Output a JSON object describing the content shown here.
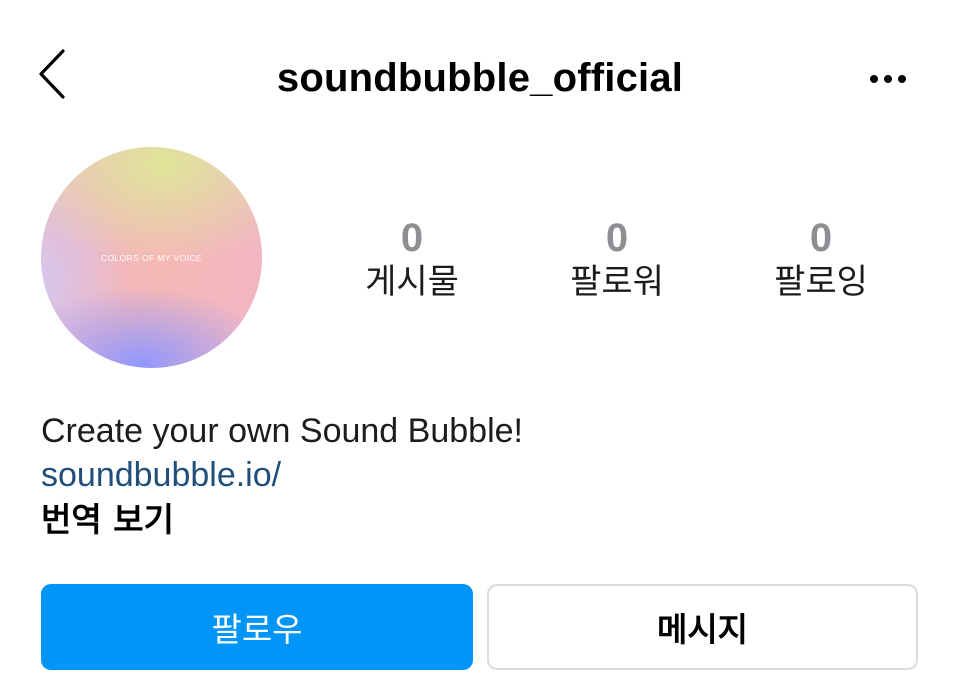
{
  "header": {
    "title": "soundbubble_official",
    "back_icon": "chevron-left-icon",
    "more_icon": "more-horizontal-icon"
  },
  "profile": {
    "avatar_text": "COLORS OF MY VOICE",
    "stats": [
      {
        "count": "0",
        "label": "게시물"
      },
      {
        "count": "0",
        "label": "팔로워"
      },
      {
        "count": "0",
        "label": "팔로잉"
      }
    ],
    "bio": "Create your own Sound Bubble!",
    "link": "soundbubble.io/",
    "translate": "번역 보기"
  },
  "actions": {
    "follow_label": "팔로우",
    "message_label": "메시지"
  },
  "colors": {
    "accent": "#0095f6",
    "link": "#1f4f7a",
    "stat_number": "#8e8e93"
  }
}
